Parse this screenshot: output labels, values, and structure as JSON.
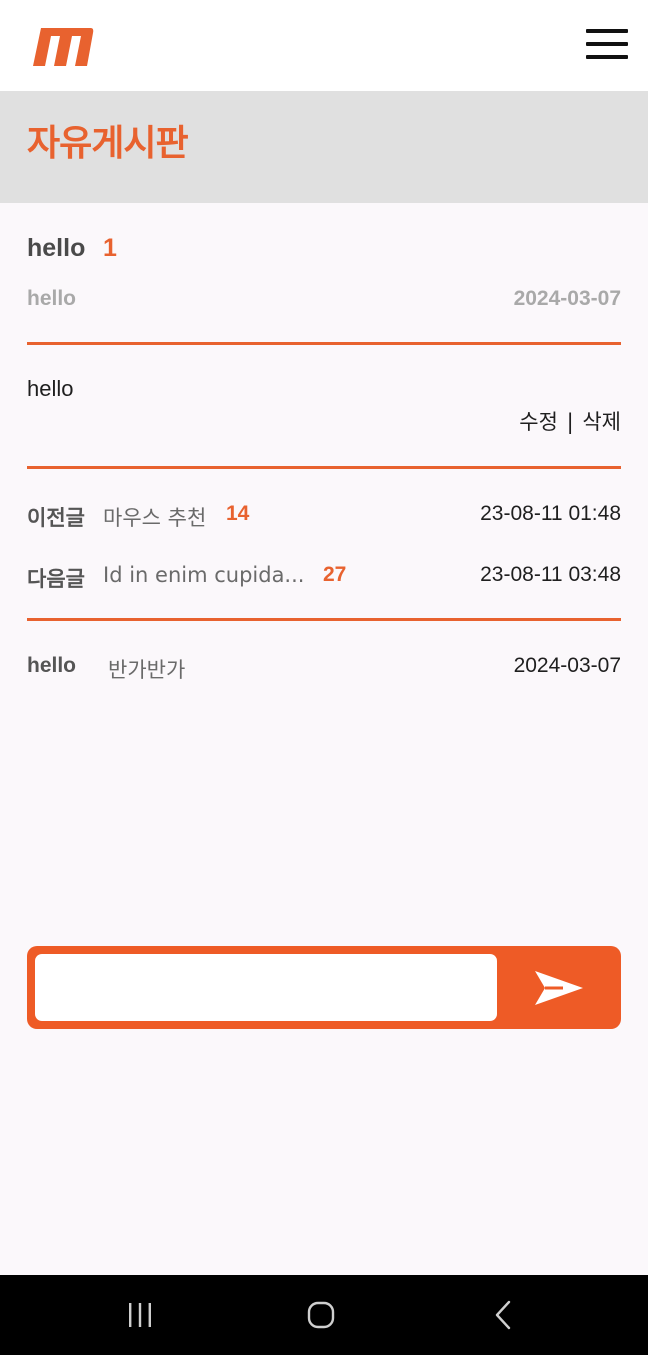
{
  "header": {
    "logo_icon": "m-logo-icon",
    "menu_icon": "hamburger-menu-icon"
  },
  "board": {
    "title": "자유게시판"
  },
  "post": {
    "title": "hello",
    "comment_count": "1",
    "author": "hello",
    "date": "2024-03-07",
    "body": "hello",
    "edit_label": "수정",
    "separator": "|",
    "delete_label": "삭제"
  },
  "navigation": {
    "prev": {
      "label": "이전글",
      "title": "마우스 추천",
      "count": "14",
      "date": "23-08-11 01:48"
    },
    "next": {
      "label": "다음글",
      "title": "Id in enim cupida...",
      "count": "27",
      "date": "23-08-11 03:48"
    }
  },
  "comments": [
    {
      "author": "hello",
      "text": "반가반가",
      "date": "2024-03-07"
    }
  ],
  "comment_form": {
    "value": "",
    "placeholder": "",
    "send_icon": "send-icon"
  },
  "colors": {
    "accent": "#e8622f",
    "form_accent": "#ee5b26",
    "title_band": "#e0e0e0",
    "background": "#fbf8fb"
  },
  "system_nav": {
    "recents_icon": "recent-apps-icon",
    "home_icon": "home-icon",
    "back_icon": "back-icon"
  }
}
